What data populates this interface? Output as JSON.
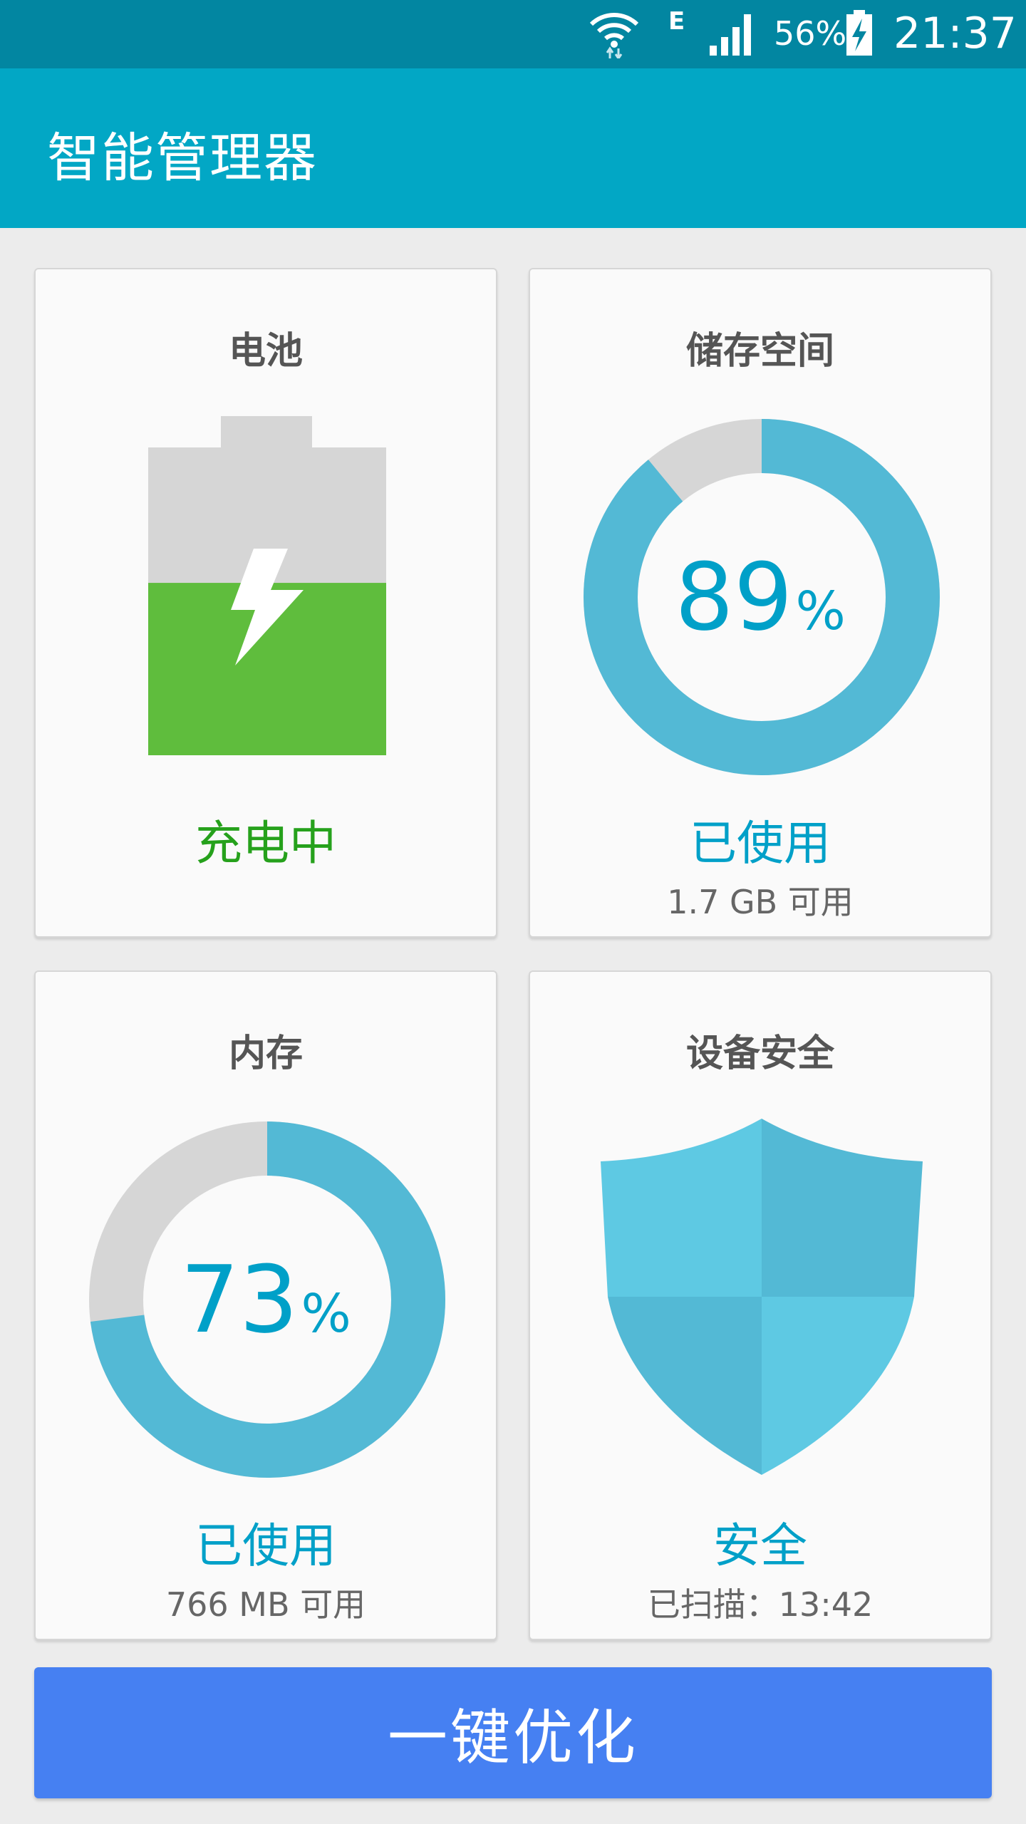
{
  "status_bar": {
    "network_type": "E",
    "battery_percent": "56%",
    "time": "21:37",
    "icons": [
      "wifi-icon",
      "signal-icon",
      "battery-charging-icon"
    ]
  },
  "app_bar": {
    "title": "智能管理器"
  },
  "cards": {
    "battery": {
      "title": "电池",
      "status": "充电中",
      "icon": "battery-charging-icon",
      "charge_fraction": 0.56,
      "status_color": "#26a11c"
    },
    "storage": {
      "title": "储存空间",
      "percent": "89",
      "percent_unit": "%",
      "used_fraction": 0.89,
      "status": "已使用",
      "subtext": "1.7 GB 可用"
    },
    "memory": {
      "title": "内存",
      "percent": "73",
      "percent_unit": "%",
      "used_fraction": 0.73,
      "status": "已使用",
      "subtext": "766 MB 可用"
    },
    "security": {
      "title": "设备安全",
      "icon": "shield-icon",
      "status": "安全",
      "subtext": "已扫描：13:42"
    }
  },
  "optimize_button": {
    "label": "一键优化"
  },
  "colors": {
    "status_bar": "#0286a1",
    "app_bar": "#02a7c5",
    "accent_blue": "#00a0c8",
    "ring_blue": "#53b9d5",
    "ring_grey": "#d6d6d6",
    "battery_green": "#5fbd3d",
    "button_blue": "#4680f2"
  }
}
